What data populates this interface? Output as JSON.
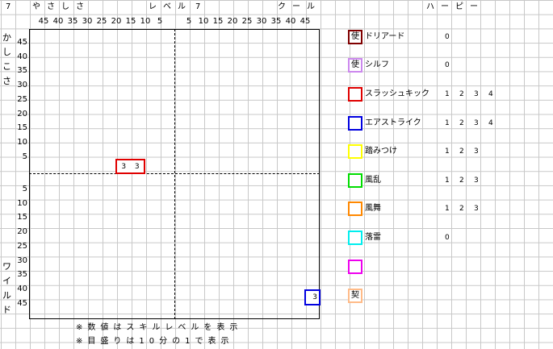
{
  "top_header": {
    "level_left_num": "7",
    "easy_label": "やさしさ",
    "level_label": "レベル",
    "level_right_num": "7",
    "cool_label": "クール",
    "harpy_label": "ハーピー"
  },
  "x_ticks_left": [
    "45",
    "40",
    "35",
    "30",
    "25",
    "20",
    "15",
    "10",
    "5"
  ],
  "x_ticks_right": [
    "5",
    "10",
    "15",
    "20",
    "25",
    "30",
    "35",
    "40",
    "45"
  ],
  "y_ticks_top": [
    "45",
    "40",
    "35",
    "30",
    "25",
    "20",
    "15",
    "10",
    "5"
  ],
  "y_ticks_bottom": [
    "5",
    "10",
    "15",
    "20",
    "25",
    "30",
    "35",
    "40",
    "45"
  ],
  "y_label_top": "かしこさ",
  "y_label_bottom": "ワイルド",
  "notes": [
    "※数値はスキルレベルを表示",
    "※目盛りは10分の1で表示"
  ],
  "markers": [
    {
      "label_a": "3",
      "label_b": "3",
      "color": "#e00000"
    },
    {
      "label_a": "3",
      "color": "#0000e0"
    }
  ],
  "legend": [
    {
      "icon": "使",
      "name": "ドリアード",
      "color": "#800000",
      "levels": [
        "0"
      ]
    },
    {
      "icon": "使",
      "name": "シルフ",
      "color": "#cc88ee",
      "levels": [
        "0"
      ]
    },
    {
      "icon": "",
      "name": "スラッシュキック",
      "color": "#e00000",
      "levels": [
        "1",
        "2",
        "3",
        "4"
      ]
    },
    {
      "icon": "",
      "name": "エアストライク",
      "color": "#0000e0",
      "levels": [
        "1",
        "2",
        "3",
        "4"
      ]
    },
    {
      "icon": "",
      "name": "踏みつけ",
      "color": "#ffff00",
      "levels": [
        "1",
        "2",
        "3"
      ]
    },
    {
      "icon": "",
      "name": "風乱",
      "color": "#00dd00",
      "levels": [
        "1",
        "2",
        "3"
      ]
    },
    {
      "icon": "",
      "name": "風舞",
      "color": "#ff8800",
      "levels": [
        "1",
        "2",
        "3"
      ]
    },
    {
      "icon": "",
      "name": "落雷",
      "color": "#00eeee",
      "levels": [
        "0"
      ]
    },
    {
      "icon": "",
      "name": "",
      "color": "#ee00ee",
      "levels": []
    },
    {
      "icon": "契",
      "name": "",
      "color": "#ffbb88",
      "levels": []
    }
  ]
}
